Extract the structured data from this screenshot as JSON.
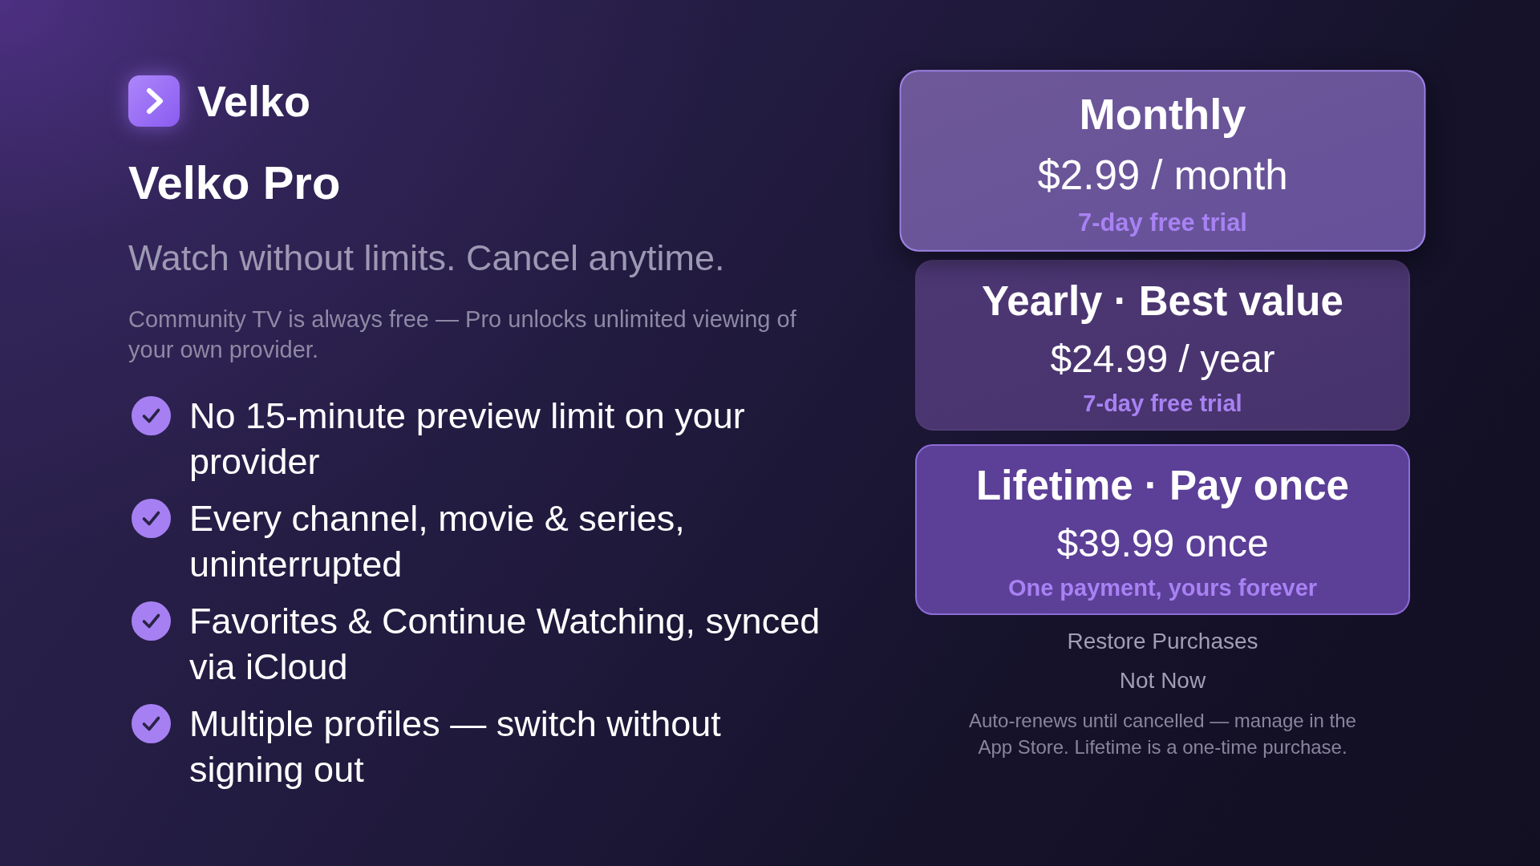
{
  "brand": {
    "name": "Velko"
  },
  "title": "Velko Pro",
  "tagline": "Watch without limits. Cancel anytime.",
  "description": "Community TV is always free — Pro unlocks unlimited viewing of your own provider.",
  "features": [
    "No 15-minute preview limit on your provider",
    "Every channel, movie & series, uninterrupted",
    "Favorites & Continue Watching, synced via iCloud",
    "Multiple profiles — switch without signing out"
  ],
  "plans": [
    {
      "name": "Monthly",
      "price": "$2.99 / month",
      "note": "7-day free trial",
      "selected": true,
      "highlighted": false
    },
    {
      "name": "Yearly · Best value",
      "price": "$24.99 / year",
      "note": "7-day free trial",
      "selected": false,
      "highlighted": false
    },
    {
      "name": "Lifetime · Pay once",
      "price": "$39.99 once",
      "note": "One payment, yours forever",
      "selected": false,
      "highlighted": true
    }
  ],
  "actions": [
    "Restore Purchases",
    "Not Now"
  ],
  "footnote": "Auto-renews until cancelled — manage in the App Store. Lifetime is a one-time purchase."
}
